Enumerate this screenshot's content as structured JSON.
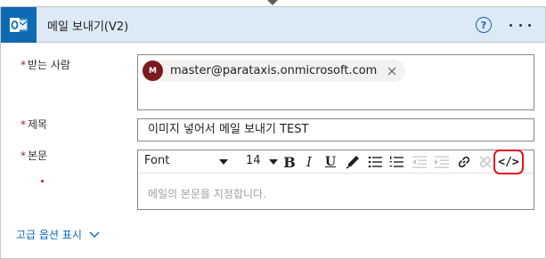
{
  "header": {
    "app_icon": "outlook-icon",
    "title": "메일 보내기(V2)",
    "help_label": "?",
    "more_icon": "more-horizontal-icon"
  },
  "fields": {
    "to": {
      "label": "받는 사람",
      "required": true,
      "recipient": {
        "initial": "M",
        "email": "master@parataxis.onmicrosoft.com",
        "avatar_color": "#7b1a1e"
      }
    },
    "subject": {
      "label": "제목",
      "required": true,
      "value": "이미지 넣어서 메일 보내기 TEST"
    },
    "body": {
      "label": "본문",
      "required": true,
      "placeholder": "메일의 본문을 지정합니다.",
      "toolbar": {
        "font": "Font",
        "size": "14",
        "bold": "B",
        "italic": "I",
        "underline": "U",
        "code_view": "</>",
        "highlight_color": "#e81123"
      }
    }
  },
  "advanced_options_label": "고급 옵션 표시",
  "colors": {
    "header_bg": "#dce9f7",
    "app_icon_bg": "#0f6ab4",
    "link": "#0f6cbd",
    "required": "#a4262c"
  }
}
